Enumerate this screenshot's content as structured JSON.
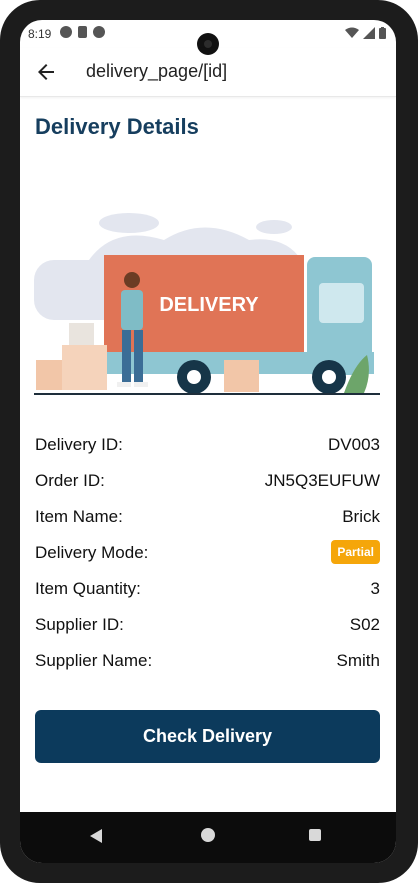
{
  "status_bar": {
    "time": "8:19"
  },
  "app_bar": {
    "title": "delivery_page/[id]"
  },
  "heading": "Delivery Details",
  "illustration": {
    "truck_label": "DELIVERY"
  },
  "details": [
    {
      "label": "Delivery ID:",
      "value": "DV003"
    },
    {
      "label": "Order ID:",
      "value": "JN5Q3EUFUW"
    },
    {
      "label": "Item Name:",
      "value": "Brick"
    },
    {
      "label": "Delivery Mode:",
      "value": "Partial"
    },
    {
      "label": "Item Quantity:",
      "value": "3"
    },
    {
      "label": "Supplier ID:",
      "value": "S02"
    },
    {
      "label": "Supplier Name:",
      "value": "Smith"
    }
  ],
  "check_button": "Check Delivery",
  "colors": {
    "primary": "#0c3a5c",
    "heading": "#163e5e",
    "badge": "#f5a60a"
  },
  "icons": [
    "back-arrow-icon",
    "wifi-icon",
    "signal-icon",
    "battery-icon",
    "nav-back-icon",
    "nav-home-icon",
    "nav-recent-icon"
  ]
}
